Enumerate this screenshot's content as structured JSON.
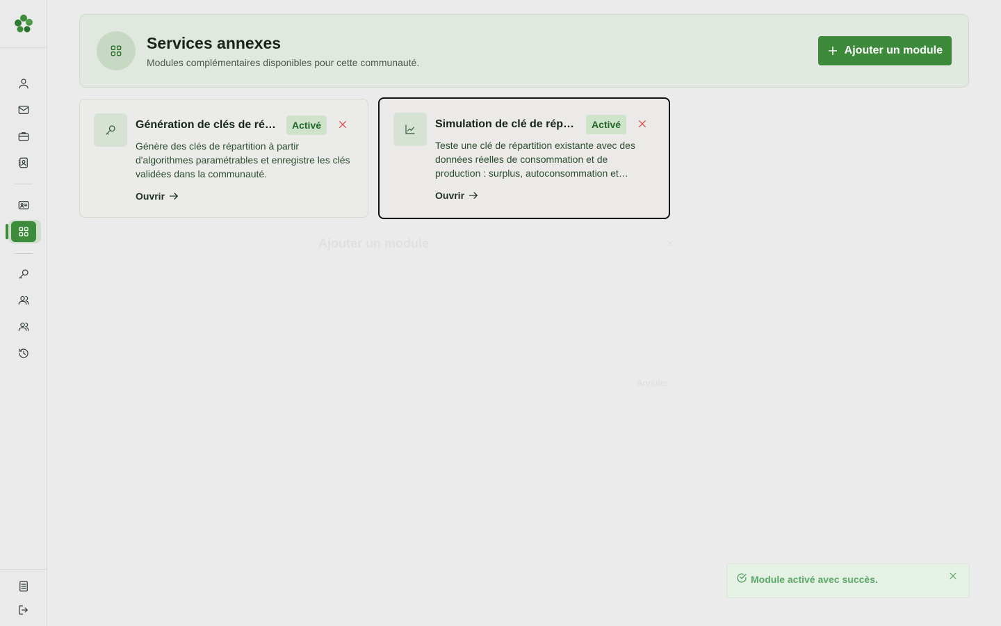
{
  "sidebar": {
    "logo": "clover-logo",
    "items": [
      {
        "icon": "user-icon"
      },
      {
        "icon": "mail-icon"
      },
      {
        "icon": "briefcase-icon"
      },
      {
        "icon": "contact-book-icon"
      },
      {
        "icon": "id-card-icon"
      },
      {
        "icon": "grid-icon",
        "active": true
      },
      {
        "icon": "key-icon"
      },
      {
        "icon": "users-icon"
      },
      {
        "icon": "users-icon"
      },
      {
        "icon": "history-icon"
      }
    ],
    "bottom": [
      {
        "icon": "document-icon"
      },
      {
        "icon": "logout-icon"
      }
    ]
  },
  "header": {
    "icon": "grid-icon",
    "title": "Services annexes",
    "subtitle": "Modules complémentaires disponibles pour cette communauté.",
    "add_button": "Ajouter un module"
  },
  "modules": [
    {
      "icon": "key-icon",
      "title": "Génération de clés de répartition",
      "badge": "Activé",
      "description": "Génère des clés de répartition à partir d'algorithmes paramétrables et enregistre les clés validées dans la communauté.",
      "open_label": "Ouvrir"
    },
    {
      "icon": "chart-icon",
      "title": "Simulation de clé de répartition",
      "badge": "Activé",
      "description": "Teste une clé de répartition existante avec des données réelles de consommation et de production : surplus, autoconsommation et…",
      "open_label": "Ouvrir"
    }
  ],
  "dialog_ghost": {
    "title": "Ajouter un module",
    "cancel": "Annuler"
  },
  "toast": {
    "icon": "check-circle-icon",
    "message": "Module activé avec succès."
  },
  "colors": {
    "accent": "#3c8a3a",
    "badge_bg": "#cfe3cb",
    "badge_text": "#21662a",
    "danger": "#d64545",
    "toast_text": "#5aa866"
  }
}
